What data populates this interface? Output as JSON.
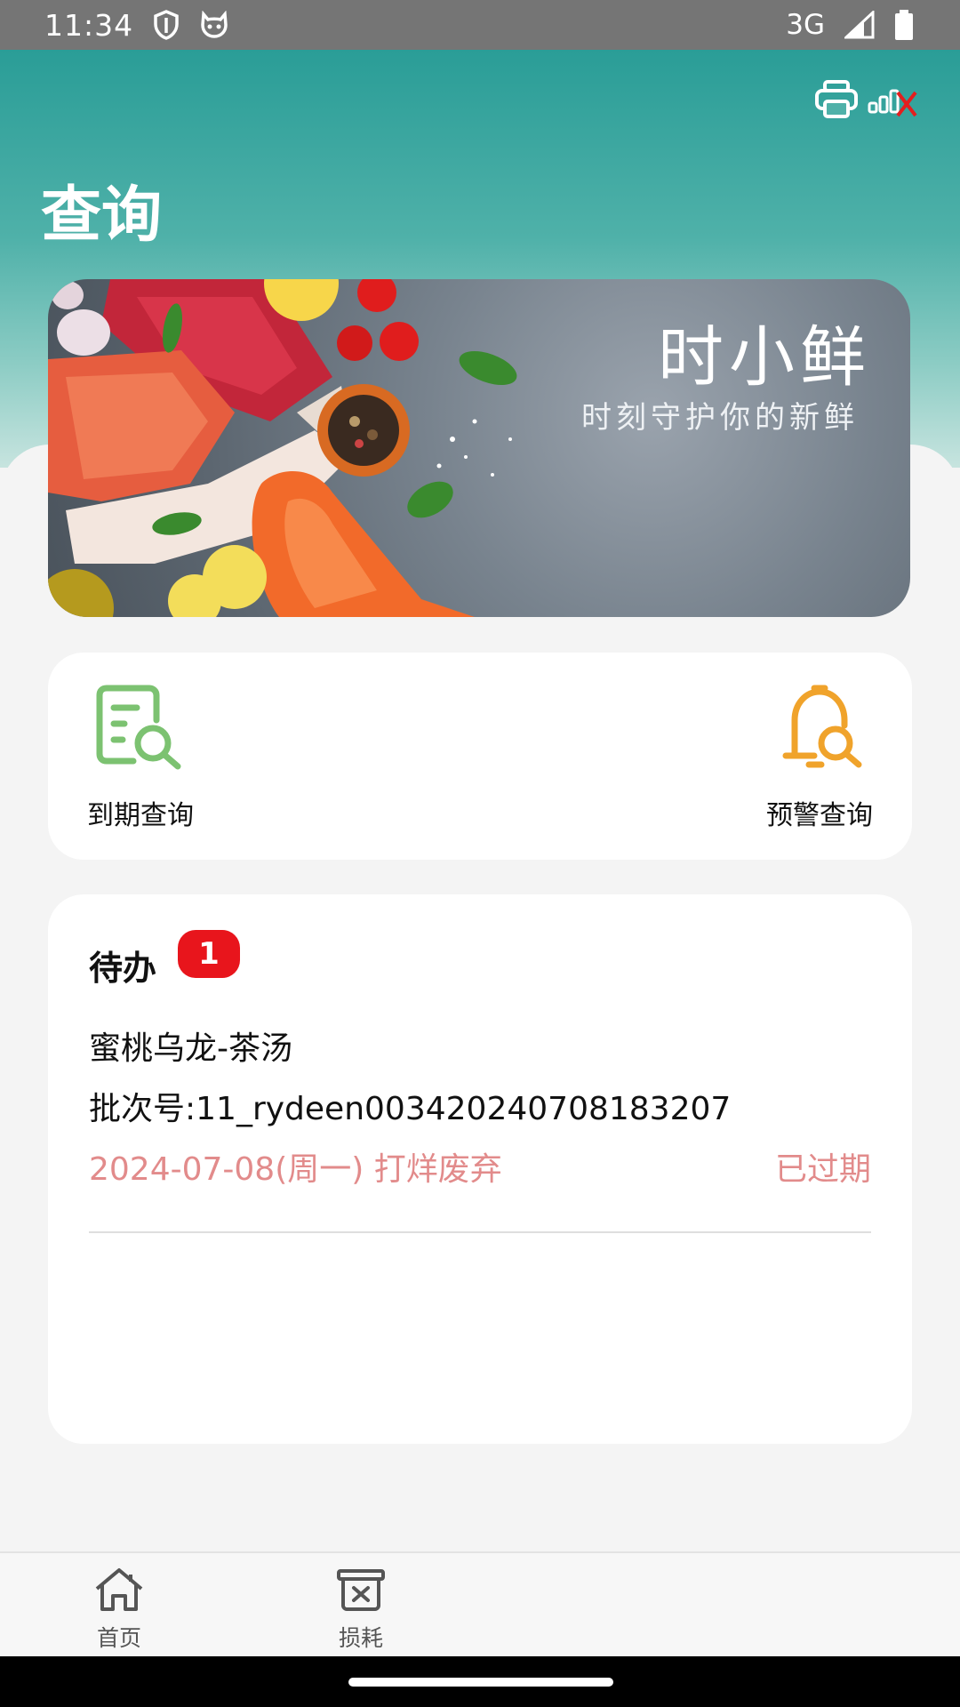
{
  "status_bar": {
    "time": "11:34",
    "network": "3G",
    "icons": [
      "shield-icon",
      "cat-face-icon",
      "signal-icon",
      "battery-icon"
    ]
  },
  "header": {
    "title": "查询",
    "tools": [
      "printer-icon",
      "printer-disconnected-icon"
    ],
    "gradient_colors": [
      "#2a9d97",
      "#c7e4df"
    ]
  },
  "banner": {
    "brand_name": "时小鲜",
    "slogan": "时刻守护你的新鲜"
  },
  "quick_actions": [
    {
      "label": "到期查询",
      "icon": "document-search-icon",
      "color": "#7cc271"
    },
    {
      "label": "预警查询",
      "icon": "bell-search-icon",
      "color": "#f0a32b"
    }
  ],
  "todo": {
    "title": "待办",
    "badge_count": "1",
    "item": {
      "name": "蜜桃乌龙-茶汤",
      "batch_label": "批次号:",
      "batch_number": "11_rydeen00342024070818320 7",
      "date_action": "2024-07-08(周一) 打烊废弃",
      "status": "已过期"
    },
    "alert_color": "#e28b8b"
  },
  "bottom_nav": [
    {
      "label": "首页",
      "icon": "home-icon"
    },
    {
      "label": "损耗",
      "icon": "trash-bin-icon"
    }
  ]
}
